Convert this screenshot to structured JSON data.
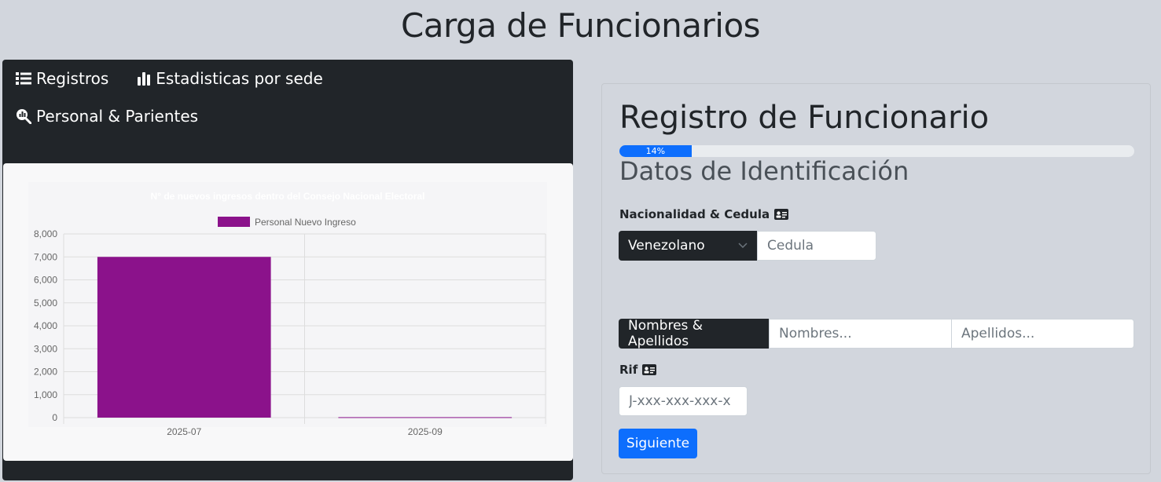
{
  "header": {
    "title": "Carga de Funcionarios"
  },
  "nav": {
    "items": [
      {
        "label": "Registros",
        "icon": "list-icon"
      },
      {
        "label": "Estadisticas por sede",
        "icon": "bar-chart-icon"
      },
      {
        "label": "Personal & Parientes",
        "icon": "search-chart-icon"
      }
    ]
  },
  "chart_data": {
    "type": "bar",
    "title": "N° de nuevos ingresos dentro del Consejo Nacional Electoral",
    "categories": [
      "2025-07",
      "2025-09"
    ],
    "series": [
      {
        "name": "Personal Nuevo Ingreso",
        "values": [
          7000,
          20
        ],
        "color": "#8b128b"
      }
    ],
    "ylim": [
      0,
      8000
    ],
    "yticks": [
      "8,000",
      "7,000",
      "6,000",
      "5,000",
      "4,000",
      "3,000",
      "2,000",
      "1,000",
      "0"
    ],
    "legend": "top",
    "grid": true
  },
  "form": {
    "title": "Registro de Funcionario",
    "progress": {
      "value": 14,
      "label": "14%"
    },
    "section": "Datos de Identificación",
    "nacionalidad_label": "Nacionalidad & Cedula",
    "nacionalidad_value": "Venezolano",
    "cedula_placeholder": "Cedula",
    "nombres_label": "Nombres & Apellidos",
    "nombres_placeholder": "Nombres...",
    "apellidos_placeholder": "Apellidos...",
    "rif_label": "Rif",
    "rif_placeholder": "J-xxx-xxx-xxx-x",
    "next_label": "Siguiente"
  },
  "colors": {
    "accent": "#0d6efd",
    "dark": "#212529",
    "bar": "#8b128b"
  }
}
